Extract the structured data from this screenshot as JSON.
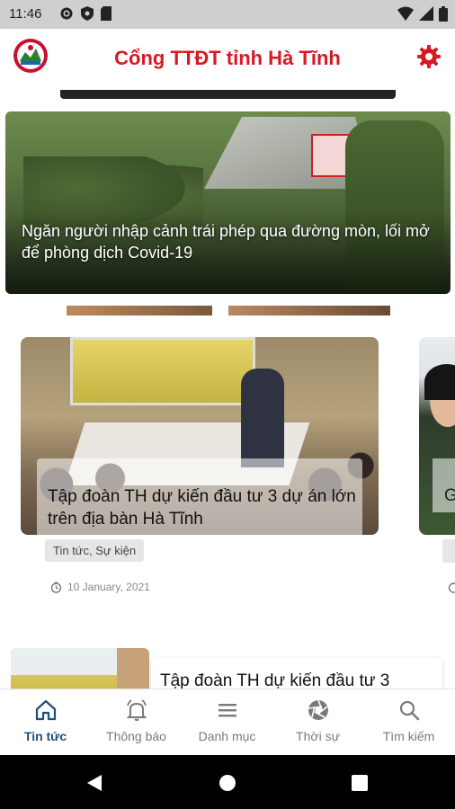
{
  "status_bar": {
    "time": "11:46"
  },
  "app_bar": {
    "title": "Cổng TTĐT tỉnh Hà Tĩnh"
  },
  "featured": {
    "title": "Ngăn người nhập cảnh trái phép qua đường mòn, lối mở để phòng dịch Covid-19"
  },
  "carousel": {
    "items": [
      {
        "title": "Tập đoàn TH dự kiến đầu tư 3 dự án lớn trên địa bàn Hà Tĩnh",
        "tag": "Tin tức, Sự kiện",
        "date": "10 January, 2021"
      },
      {
        "title": "G"
      }
    ]
  },
  "list": {
    "items": [
      {
        "title": "Tập đoàn TH dự kiến đầu tư 3"
      }
    ]
  },
  "bottom_nav": {
    "items": [
      {
        "label": "Tin tức",
        "icon": "home-icon",
        "active": true
      },
      {
        "label": "Thông báo",
        "icon": "bell-icon"
      },
      {
        "label": "Danh mục",
        "icon": "menu-icon"
      },
      {
        "label": "Thời sự",
        "icon": "aperture-icon"
      },
      {
        "label": "Tìm kiếm",
        "icon": "search-icon"
      }
    ]
  },
  "colors": {
    "brand_red": "#d71921",
    "active_nav": "#1f4e79",
    "status_bar": "#cfcfcf"
  }
}
